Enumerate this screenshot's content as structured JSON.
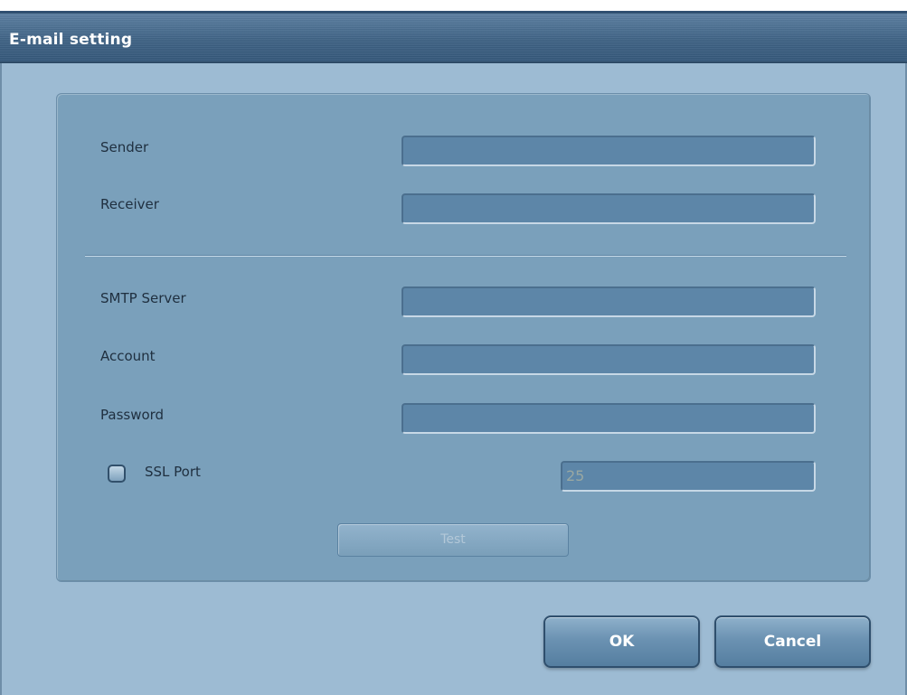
{
  "window": {
    "title": "E-mail setting"
  },
  "form": {
    "sender": {
      "label": "Sender",
      "value": ""
    },
    "receiver": {
      "label": "Receiver",
      "value": ""
    },
    "smtp_server": {
      "label": "SMTP Server",
      "value": ""
    },
    "account": {
      "label": "Account",
      "value": ""
    },
    "password": {
      "label": "Password",
      "value": ""
    },
    "ssl": {
      "label": "SSL Port",
      "checked": false,
      "port": "25"
    },
    "test_label": "Test"
  },
  "buttons": {
    "ok_label": "OK",
    "cancel_label": "Cancel"
  },
  "colors": {
    "background": "#9dbbd3",
    "panel": "#7aa0bb",
    "titlebar": "#3f6385",
    "field": "#5d86a8"
  }
}
